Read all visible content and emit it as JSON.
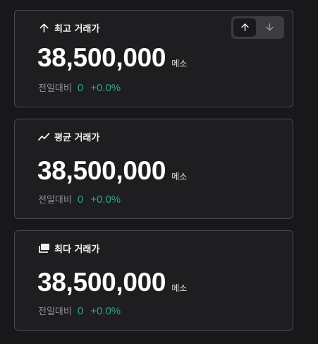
{
  "cards": [
    {
      "title": "최고 거래가",
      "icon": "arrow-up-icon",
      "price": "38,500,000",
      "unit": "메소",
      "change_label": "전일대비",
      "change_amount": "0",
      "change_percent": "+0.0%",
      "toggle": {
        "options": [
          "up-arrow",
          "down-arrow"
        ],
        "selected": "up-arrow"
      }
    },
    {
      "title": "평균 거래가",
      "icon": "trend-line-icon",
      "price": "38,500,000",
      "unit": "메소",
      "change_label": "전일대비",
      "change_amount": "0",
      "change_percent": "+0.0%"
    },
    {
      "title": "최다 거래가",
      "icon": "stacked-cards-icon",
      "price": "38,500,000",
      "unit": "메소",
      "change_label": "전일대비",
      "change_amount": "0",
      "change_percent": "+0.0%"
    }
  ],
  "colors": {
    "background": "#18181b",
    "card": "#1e1e21",
    "border": "#4a4a4f",
    "positive": "#2fa58a",
    "muted": "#8f8f95"
  }
}
